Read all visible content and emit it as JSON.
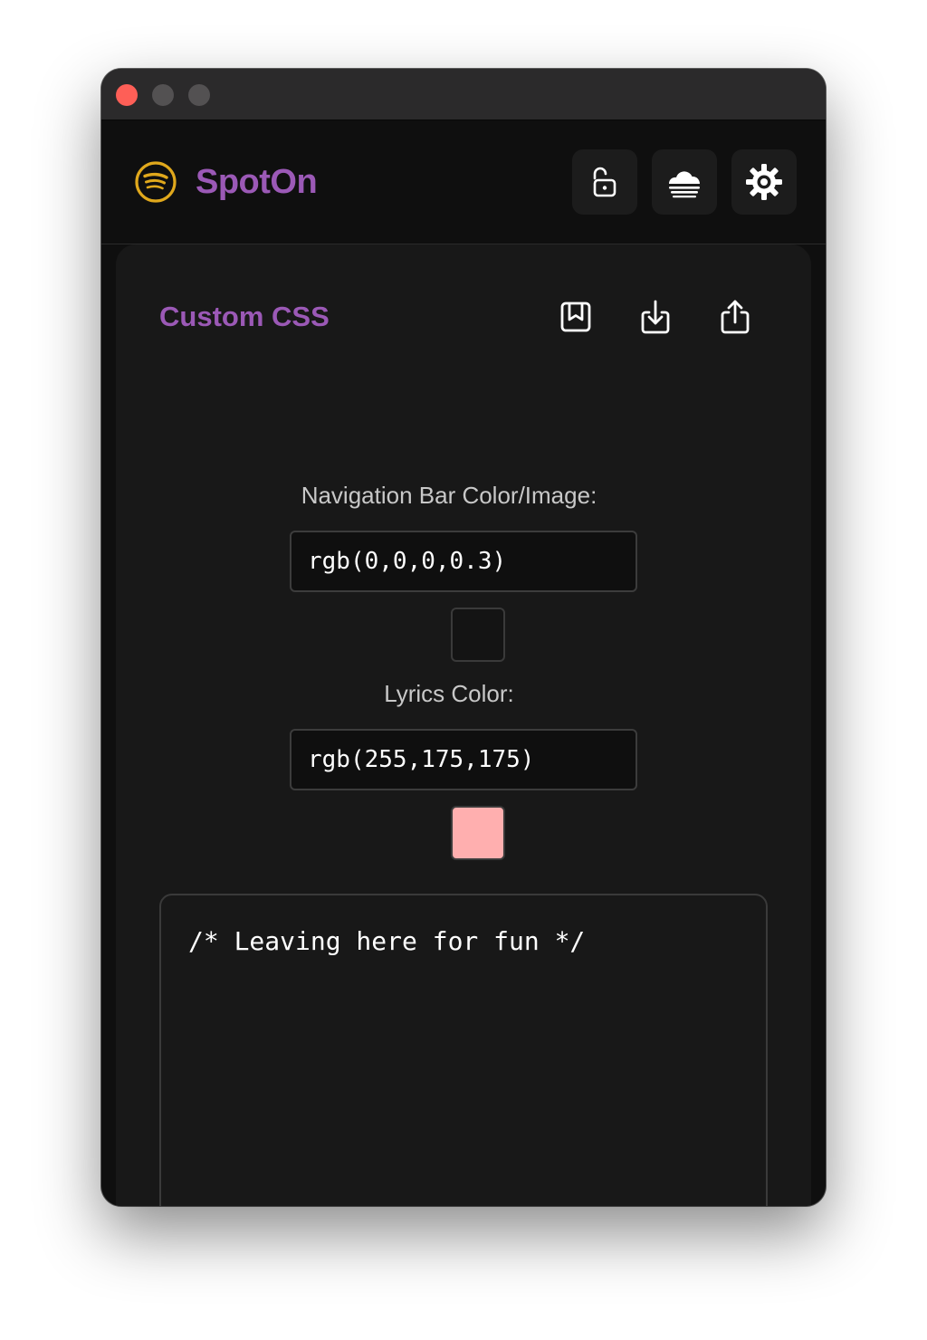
{
  "window": {
    "controls": [
      "close-button",
      "minimize-button",
      "maximize-button"
    ]
  },
  "header": {
    "app_name": "SpotOn",
    "logo_icon": "spotify-logo-icon",
    "buttons": [
      {
        "name": "unlock-button",
        "icon": "unlock-icon"
      },
      {
        "name": "cloud-button",
        "icon": "cloud-icon"
      },
      {
        "name": "settings-button",
        "icon": "gear-icon"
      }
    ]
  },
  "panel": {
    "title": "Custom CSS",
    "actions": [
      {
        "name": "save-button",
        "icon": "bookmark-save-icon"
      },
      {
        "name": "import-button",
        "icon": "download-icon"
      },
      {
        "name": "export-button",
        "icon": "share-icon"
      }
    ],
    "nav_bar": {
      "label": "Navigation Bar Color/Image:",
      "value": "rgb(0,0,0,0.3)"
    },
    "lyrics": {
      "label": "Lyrics Color:",
      "value": "rgb(255,175,175)"
    },
    "css_editor": {
      "content": "/* Leaving here for fun */"
    }
  },
  "colors": {
    "accent": "#9b59b6",
    "logo": "#e0a81c",
    "nav_swatch": "#141414",
    "lyrics_swatch": "#ffafaf",
    "close": "#fe5f57"
  }
}
